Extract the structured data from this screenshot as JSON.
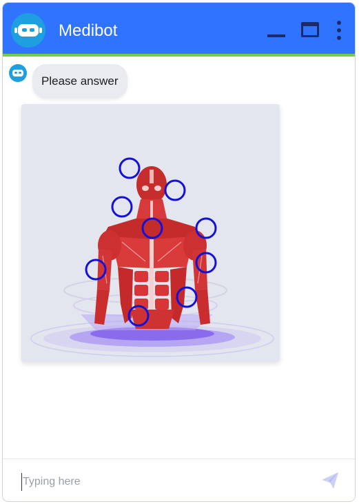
{
  "app": {
    "title": "Medibot"
  },
  "header": {
    "avatar_icon": "robot-icon",
    "minimize_icon": "minimize-icon",
    "maximize_icon": "maximize-icon",
    "more_icon": "more-vertical-icon",
    "color": "#2f73ff",
    "accent": "#7cc847"
  },
  "messages": [
    {
      "sender": "bot",
      "avatar_icon": "robot-icon",
      "text": "Please answer"
    }
  ],
  "image_card": {
    "image": "human-muscle-anatomy-illustration",
    "hotspot_count": 10,
    "hotspot_color": "#1410d8"
  },
  "composer": {
    "placeholder": "Typing here",
    "value": "",
    "send_icon": "send-icon"
  }
}
